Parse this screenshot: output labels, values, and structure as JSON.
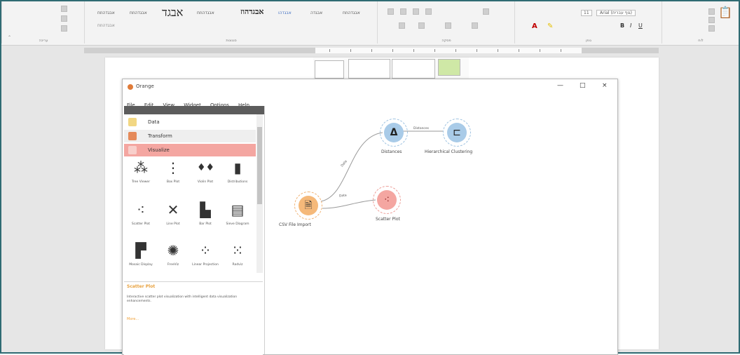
{
  "ribbon": {
    "group_labels": [
      "לוח",
      "גופן",
      "פסקה",
      "סגנונות",
      "עריכה"
    ],
    "style_names": [
      "אבגדהוזח",
      "אבגדהוזח",
      "אבגדהוזח",
      "אבגד",
      "אבגדהוז",
      "אבגדהו",
      "אבגדה",
      "אבגדהו",
      "אבגדהוזח",
      "אבגדהוזח"
    ],
    "font_name": "Arial (גוף עברית)",
    "font_size": "11"
  },
  "orange": {
    "title": "Orange",
    "window_controls": {
      "minimize": "—",
      "maximize": "□",
      "close": "×"
    },
    "menu": [
      "File",
      "Edit",
      "View",
      "Widget",
      "Options",
      "Help"
    ],
    "categories": [
      {
        "label": "Data",
        "color": "#f2d783"
      },
      {
        "label": "Transform",
        "color": "#e58a5a"
      },
      {
        "label": "Visualize",
        "color": "#f4a6a1"
      }
    ],
    "widgets": [
      {
        "label": "Tree Viewer",
        "icon": "tree-viewer-icon",
        "glyph": "⁂"
      },
      {
        "label": "Box Plot",
        "icon": "box-plot-icon",
        "glyph": "⋮"
      },
      {
        "label": "Violin Plot",
        "icon": "violin-plot-icon",
        "glyph": "♦♦"
      },
      {
        "label": "Distributions",
        "icon": "distributions-icon",
        "glyph": "▮"
      },
      {
        "label": "Scatter Plot",
        "icon": "scatter-plot-icon",
        "glyph": "⁖"
      },
      {
        "label": "Line Plot",
        "icon": "line-plot-icon",
        "glyph": "✕"
      },
      {
        "label": "Bar Plot",
        "icon": "bar-plot-icon",
        "glyph": "▙"
      },
      {
        "label": "Sieve Diagram",
        "icon": "sieve-diagram-icon",
        "glyph": "▤"
      },
      {
        "label": "Mosaic Display",
        "icon": "mosaic-display-icon",
        "glyph": "▛"
      },
      {
        "label": "FreeViz",
        "icon": "freeviz-icon",
        "glyph": "✺"
      },
      {
        "label": "Linear Projection",
        "icon": "linear-projection-icon",
        "glyph": "⁘"
      },
      {
        "label": "Radviz",
        "icon": "radviz-icon",
        "glyph": "⁙"
      }
    ],
    "info": {
      "title": "Scatter Plot",
      "description": "Interactive scatter plot visualization with intelligent data visualization enhancements.",
      "more": "More..."
    },
    "nodes": {
      "csv": {
        "label": "CSV File Import",
        "color": "#f5b97a",
        "icon": "csv-file-import-icon"
      },
      "distances": {
        "label": "Distances",
        "color": "#a9cbe8",
        "icon": "distances-icon"
      },
      "hierarchical": {
        "label": "Hierarchical Clustering",
        "color": "#a9cbe8",
        "icon": "hierarchical-clustering-icon"
      },
      "scatter": {
        "label": "Scatter Plot",
        "color": "#f4a6a1",
        "icon": "scatter-plot-node-icon"
      }
    },
    "links": {
      "csv_distances": "Data",
      "csv_scatter": "Data",
      "distances_hierarchical": "Distances"
    }
  }
}
